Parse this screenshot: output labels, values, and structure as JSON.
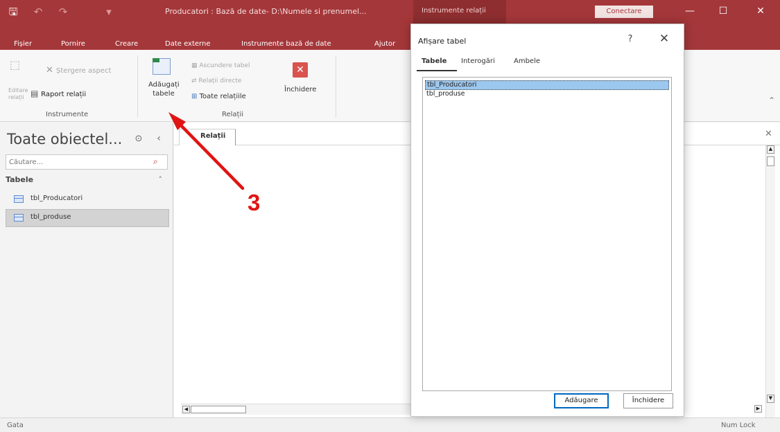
{
  "window": {
    "title": "Producatori : Bază de date- D:\\Numele si prenumel...",
    "context_tab": "Instrumente relații",
    "sign_in": "Conectare",
    "icons": [
      "save-icon",
      "undo-icon",
      "redo-icon",
      "customize-icon",
      "minimize-icon",
      "maximize-icon",
      "close-icon"
    ]
  },
  "ribbon_tabs": [
    "Fișier",
    "Pornire",
    "Creare",
    "Date externe",
    "Instrumente bază de date",
    "Ajutor"
  ],
  "ribbon": {
    "group_tools": {
      "edit_relationships": "Editare relații",
      "clear_layout": "Ștergere aspect",
      "relationship_report": "Raport relații",
      "label": "Instrumente"
    },
    "group_relationships": {
      "add_tables": "Adăugați tabele",
      "hide_table": "Ascundere tabel",
      "direct_relationships": "Relații directe",
      "all_relationships": "Toate relațiile",
      "close": "Închidere",
      "label": "Relații"
    }
  },
  "nav": {
    "title": "Toate obiectel...",
    "search_placeholder": "Căutare...",
    "group": "Tabele",
    "items": [
      "tbl_Producatori",
      "tbl_produse"
    ],
    "selected_index": 1
  },
  "document": {
    "tab": "Relații"
  },
  "status": {
    "left": "Gata",
    "right": "Num Lock"
  },
  "dialog": {
    "title": "Afișare tabel",
    "help": "?",
    "tabs": [
      "Tabele",
      "Interogări",
      "Ambele"
    ],
    "active_tab": "Tabele",
    "items": [
      "tbl_Producatori",
      "tbl_produse"
    ],
    "selected_index": 0,
    "add_button": "Adăugare",
    "close_button": "Închidere"
  },
  "annotation": {
    "step": "3",
    "color": "#e01414"
  },
  "colors": {
    "accent": "#a4373a",
    "selection": "#9cc7ee"
  }
}
